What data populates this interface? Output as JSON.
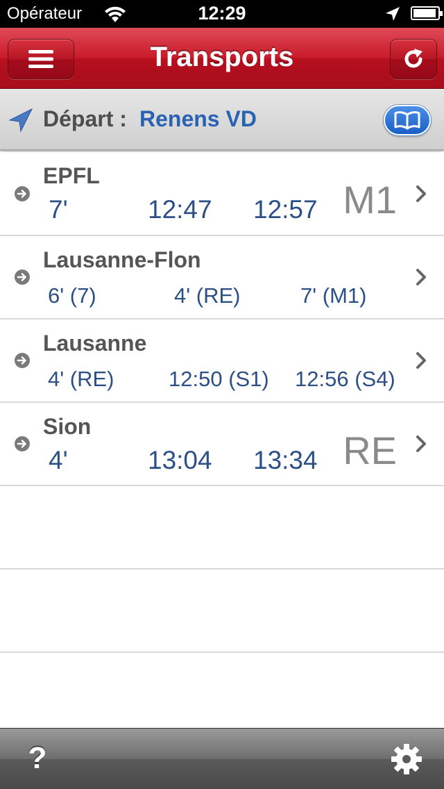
{
  "status": {
    "carrier": "Opérateur",
    "time": "12:29",
    "battery_level": 0.95
  },
  "nav": {
    "title": "Transports",
    "left_icon": "menu-icon",
    "right_icon": "refresh-icon"
  },
  "departure": {
    "label": "Départ :",
    "station": "Renens VD",
    "book_icon": "book-icon"
  },
  "colors": {
    "nav_red": "#c81a2a",
    "link_blue": "#2a62b3",
    "time_blue": "#2c4f86"
  },
  "rows": [
    {
      "name": "EPFL",
      "times": [
        "7'",
        "12:47",
        "12:57"
      ],
      "line": "M1",
      "style": "big"
    },
    {
      "name": "Lausanne-Flon",
      "times": [
        "6' (7)",
        "4' (RE)",
        "7' (M1)"
      ],
      "line": "",
      "style": "small"
    },
    {
      "name": "Lausanne",
      "times": [
        "4' (RE)",
        "12:50 (S1)",
        "12:56 (S4)"
      ],
      "line": "",
      "style": "small"
    },
    {
      "name": "Sion",
      "times": [
        "4'",
        "13:04",
        "13:34"
      ],
      "line": "RE",
      "style": "big"
    }
  ],
  "toolbar": {
    "help_label": "?",
    "settings_icon": "gear-icon"
  }
}
